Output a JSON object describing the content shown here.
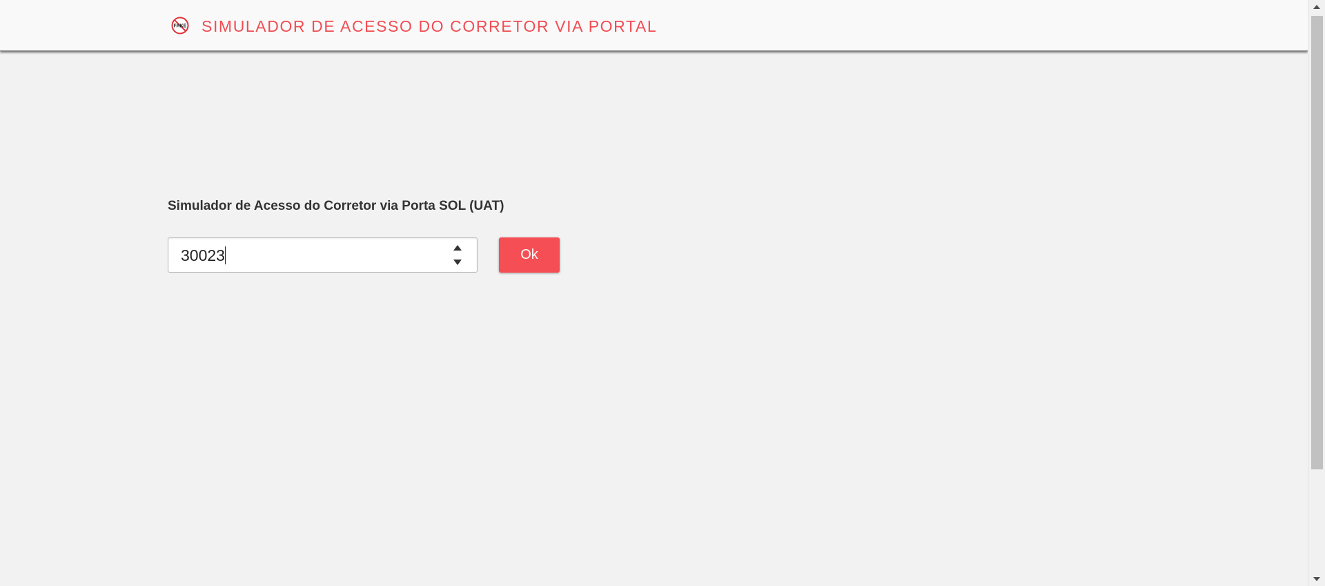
{
  "header": {
    "title": "SIMULADOR DE ACESSO DO CORRETOR VIA PORTAL",
    "logo_text": "FAKE",
    "logo_icon": "fake-stamp-icon",
    "title_color": "#f04d53"
  },
  "form": {
    "label": "Simulador de Acesso do Corretor via Porta SOL (UAT)",
    "input_value": "30023",
    "submit_label": "Ok",
    "button_color": "#f64e55"
  },
  "icons": {
    "spin_up": "triangle-up-icon",
    "spin_down": "triangle-down-icon",
    "scroll_up": "scroll-up-arrow-icon",
    "scroll_down": "scroll-down-arrow-icon"
  }
}
